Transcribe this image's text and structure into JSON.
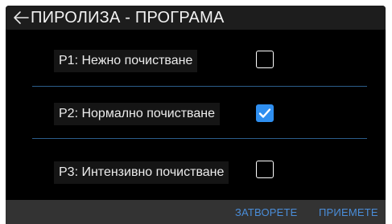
{
  "header": {
    "back_icon": "arrow-left-icon",
    "title": "ПИРОЛИЗА - ПРОГРАМА"
  },
  "options": [
    {
      "label": "P1: Нежно почистване",
      "checked": false
    },
    {
      "label": "P2: Нормално почистване",
      "checked": true
    },
    {
      "label": "P3: Интензивно почистване",
      "checked": false
    }
  ],
  "footer": {
    "close_label": "ЗАТВОРЕТЕ",
    "accept_label": "ПРИЕМЕТЕ"
  },
  "colors": {
    "accent": "#2f8ff0",
    "divider": "#2b5d8a",
    "footer_text": "#4a8dd9"
  }
}
